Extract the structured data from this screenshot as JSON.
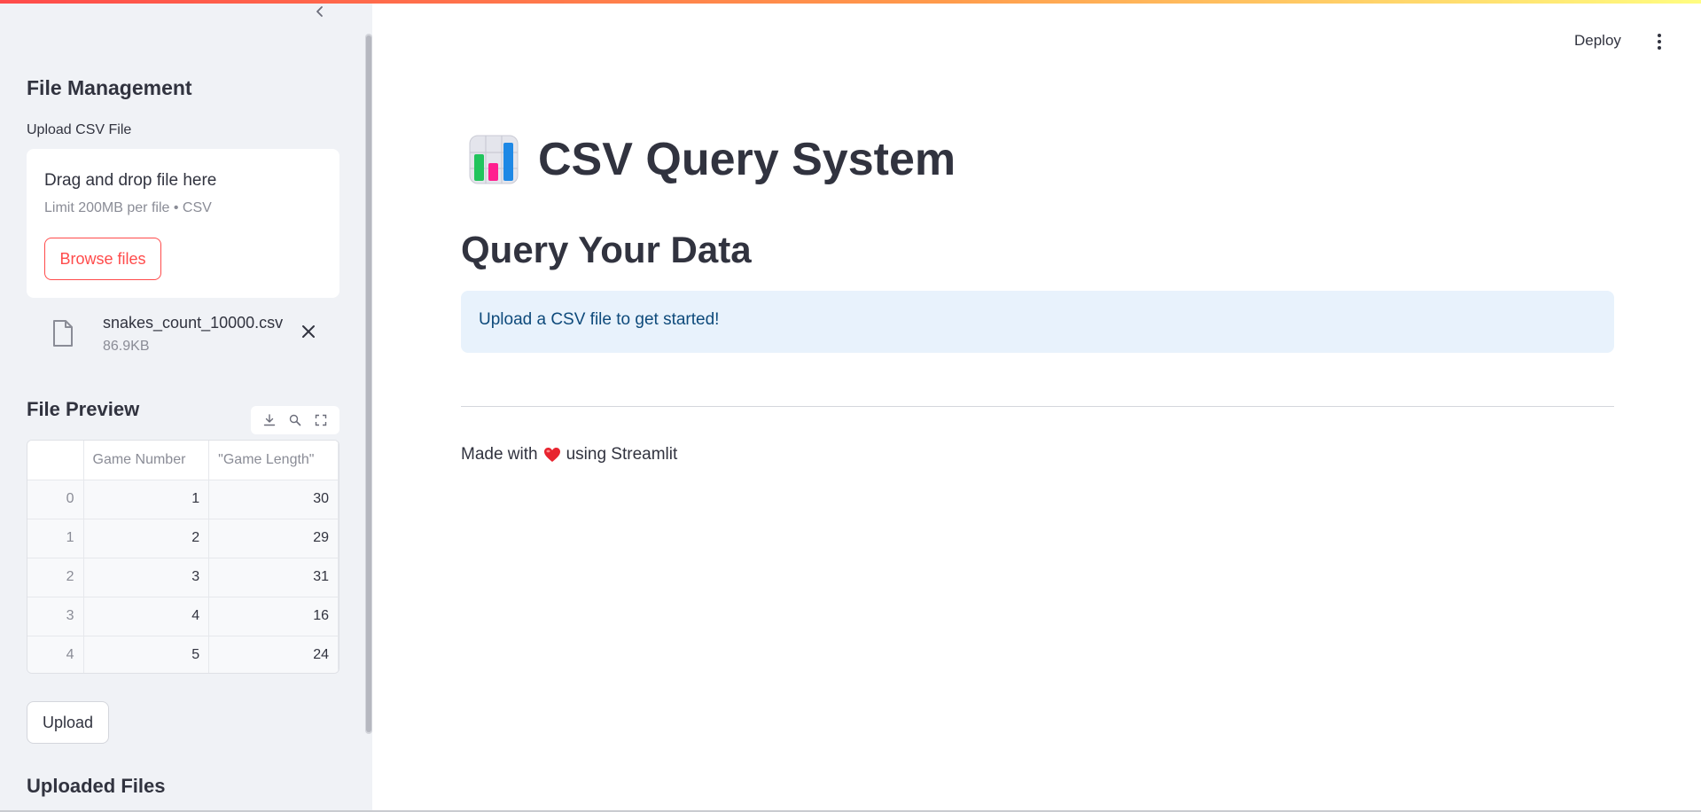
{
  "header": {
    "deploy_label": "Deploy",
    "menu_icon": "kebab-menu-icon"
  },
  "sidebar": {
    "collapse_icon": "chevron-left-icon",
    "file_management_heading": "File Management",
    "uploader": {
      "label": "Upload CSV File",
      "drop_text": "Drag and drop file here",
      "limit_text": "Limit 200MB per file • CSV",
      "browse_label": "Browse files",
      "accent_color": "#ff4b4b"
    },
    "uploaded_file": {
      "name": "snakes_count_10000.csv",
      "size": "86.9KB",
      "icon": "file-icon",
      "remove_icon": "close-icon"
    },
    "file_preview_heading": "File Preview",
    "toolbar_icons": [
      "download-icon",
      "search-icon",
      "fullscreen-icon"
    ],
    "preview_table": {
      "columns": [
        "",
        "Game Number",
        "\"Game Length\""
      ],
      "rows": [
        [
          "0",
          "1",
          "30"
        ],
        [
          "1",
          "2",
          "29"
        ],
        [
          "2",
          "3",
          "31"
        ],
        [
          "3",
          "4",
          "16"
        ],
        [
          "4",
          "5",
          "24"
        ]
      ]
    },
    "upload_button_label": "Upload",
    "uploaded_files_heading": "Uploaded Files"
  },
  "main": {
    "app_icon": "bar-chart-icon",
    "title": "CSV Query System",
    "subtitle": "Query Your Data",
    "info_message": "Upload a CSV file to get started!",
    "info_bg_color": "#e8f2fc",
    "footer_before": "Made with",
    "footer_heart_icon": "heart-icon",
    "footer_after": "using Streamlit"
  }
}
